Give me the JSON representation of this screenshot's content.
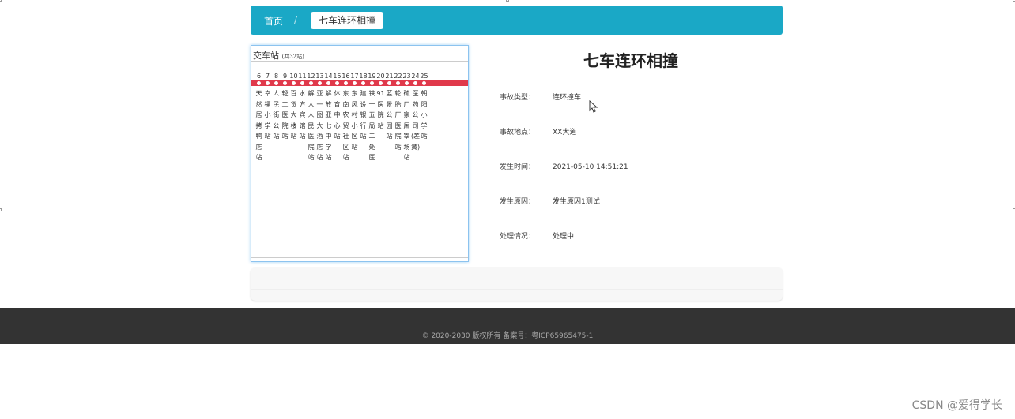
{
  "breadcrumb": {
    "home": "首页",
    "separator": "/",
    "current": "七车连环相撞"
  },
  "route": {
    "name": "交车站",
    "count_note": "(共32站)",
    "numbers": [
      "6",
      "7",
      "8",
      "9",
      "10",
      "11",
      "12",
      "13",
      "14",
      "15",
      "16",
      "17",
      "18",
      "19",
      "20",
      "21",
      "22",
      "23",
      "24",
      "25"
    ],
    "stations": [
      "天然居拷鸭店站",
      "幸福小学站",
      "人民街公站",
      "轻工医院站",
      "百货大楼站",
      "水方宾馆站",
      "解人人民医院站",
      "亚一图大酒店站",
      "解放亚七中学站",
      "体育中心站",
      "东南农贸社区站",
      "东风村小区站",
      "建设银行站",
      "铁十五局二处医",
      "91医院站",
      "蓝景公园站",
      "轮胎厂医院站",
      "硫厂家屠宰场站",
      "医药公司(差黄)",
      "朝阳小学站"
    ]
  },
  "detail": {
    "title": "七车连环相撞",
    "rows": [
      {
        "label": "事故类型：",
        "value": "连环撞车"
      },
      {
        "label": "事故地点：",
        "value": "XX大道"
      },
      {
        "label": "发生时间：",
        "value": "2021-05-10 14:51:21"
      },
      {
        "label": "发生原因：",
        "value": "发生原因1测试"
      },
      {
        "label": "处理情况：",
        "value": "处理中"
      }
    ]
  },
  "footer": {
    "text": "© 2020-2030 版权所有 备案号：粤ICP65965475-1"
  },
  "watermark": "CSDN @爱得学长",
  "colors": {
    "breadcrumb_bg": "#1aa8c6",
    "track": "#e0394b",
    "footer_bg": "#333333"
  }
}
